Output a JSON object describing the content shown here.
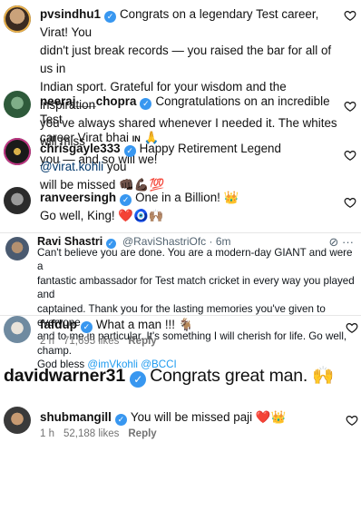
{
  "comments": [
    {
      "username": "pvsindhu1",
      "text": "Congrats on a legendary Test career, Virat! You didn't just break records — you raised the bar for all of us in Indian sport. Grateful for your wisdom and the inspiration you've always shared whenever I needed it. The whites will miss you — and so will we!",
      "line1": "Congrats on a legendary Test career, Virat! You",
      "line2": "didn't just break records — you raised the bar for all of us in",
      "line3": "Indian sport. Grateful for your wisdom and the inspiration",
      "line4": "you've always shared whenever I needed it. The whites will miss",
      "line5": "you — and so will we!"
    },
    {
      "username": "neeraj___chopra",
      "line1": "Congratulations on an incredible Test",
      "line2": "career Virat bhai",
      "flag_text": "IN",
      "emoji": "🙏"
    },
    {
      "username": "chrisgayle333",
      "line1_pre": "Happy Retirement Legend ",
      "mention": "@virat.kohli",
      "line1_post": " you",
      "line2": "will be missed",
      "emoji": "👊🏿💪🏿💯"
    },
    {
      "username": "ranveersingh",
      "line1": "One in a Billion!",
      "line1_emoji": "👑",
      "line2": "Go well, King!",
      "line2_emoji": "❤️🧿🙌🏽"
    }
  ],
  "tweet": {
    "name": "Ravi Shastri",
    "handle": "@RaviShastriOfc · 6m",
    "line1": "Can't believe you are done. You are a modern-day GIANT and were a",
    "line2": "fantastic ambassador for Test match cricket in every way you played and",
    "line3": "captained. Thank you for the lasting memories you've given to everyone,",
    "line4": "and to me in particular. It's something I will cherish for life. Go well, champ.",
    "line5_pre": "God bless ",
    "line5_links": "@imVkohli @BCCI"
  },
  "fafdup": {
    "username": "fafdup",
    "text": "What a man !!!",
    "emoji": "🐐",
    "time": "2 h",
    "likes": "71,695 likes",
    "reply": "Reply"
  },
  "davidwarner": {
    "username": "davidwarner31",
    "text": "Congrats great man.",
    "emoji": "🙌"
  },
  "shubmangill": {
    "username": "shubmangill",
    "text": "You will be missed paji",
    "emoji": "❤️👑",
    "time": "1 h",
    "likes": "52,188 likes",
    "reply": "Reply"
  },
  "colors": {
    "verified": "#3897f0",
    "meta_gray": "#737373",
    "link_blue": "#1d9bf0",
    "mention": "#00376b"
  },
  "icons": [
    "heart-icon",
    "verified-icon",
    "grok-icon",
    "more-icon"
  ]
}
